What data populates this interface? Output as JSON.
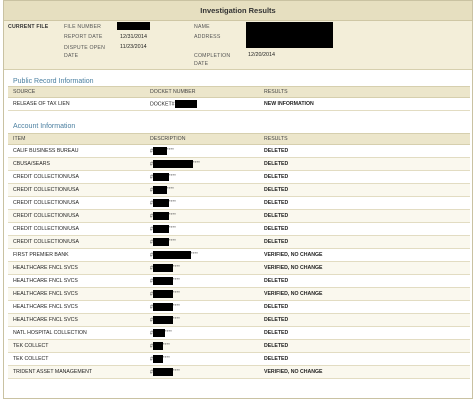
{
  "page_title": "Investigation Results",
  "summary": {
    "current_file_label": "CURRENT FILE",
    "file_number_label": "FILE NUMBER",
    "report_date_label": "REPORT DATE",
    "report_date": "12/31/2014",
    "dispute_open_label": "DISPUTE OPEN DATE",
    "dispute_open_date": "11/23/2014",
    "name_label": "NAME",
    "address_label": "ADDRESS",
    "completion_label": "COMPLETION DATE",
    "completion_date": "12/20/2014"
  },
  "public_record": {
    "title": "Public Record Information",
    "headers": [
      "SOURCE",
      "DOCKET NUMBER",
      "RESULTS"
    ],
    "rows": [
      {
        "source": "RELEASE OF TAX LIEN",
        "docket": "DOCKET#",
        "result": "NEW INFORMATION"
      }
    ]
  },
  "accounts": {
    "title": "Account Information",
    "headers": [
      "ITEM",
      "DESCRIPTION",
      "RESULTS"
    ],
    "rows": [
      {
        "item": "CALIF BUSINESS BUREAU",
        "desc_prefix": "#",
        "desc_suffix": "****",
        "result": "DELETED"
      },
      {
        "item": "CBUSA/SEARS",
        "desc_prefix": "#",
        "desc_suffix": "****",
        "result": "DELETED"
      },
      {
        "item": "CREDIT COLLECTION/USA",
        "desc_prefix": "#",
        "desc_suffix": "****",
        "result": "DELETED"
      },
      {
        "item": "CREDIT COLLECTION/USA",
        "desc_prefix": "#",
        "desc_suffix": "****",
        "result": "DELETED"
      },
      {
        "item": "CREDIT COLLECTION/USA",
        "desc_prefix": "#",
        "desc_suffix": "****",
        "result": "DELETED"
      },
      {
        "item": "CREDIT COLLECTION/USA",
        "desc_prefix": "#",
        "desc_suffix": "****",
        "result": "DELETED"
      },
      {
        "item": "CREDIT COLLECTION/USA",
        "desc_prefix": "#",
        "desc_suffix": "****",
        "result": "DELETED"
      },
      {
        "item": "CREDIT COLLECTION/USA",
        "desc_prefix": "#",
        "desc_suffix": "****",
        "result": "DELETED"
      },
      {
        "item": "FIRST PREMIER BANK",
        "desc_prefix": "#",
        "desc_suffix": "****",
        "result": "VERIFIED, NO CHANGE"
      },
      {
        "item": "HEALTHCARE FNCL SVCS",
        "desc_prefix": "#",
        "desc_suffix": "****",
        "result": "VERIFIED, NO CHANGE"
      },
      {
        "item": "HEALTHCARE FNCL SVCS",
        "desc_prefix": "#",
        "desc_suffix": "****",
        "result": "DELETED"
      },
      {
        "item": "HEALTHCARE FNCL SVCS",
        "desc_prefix": "#",
        "desc_suffix": "****",
        "result": "VERIFIED, NO CHANGE"
      },
      {
        "item": "HEALTHCARE FNCL SVCS",
        "desc_prefix": "#",
        "desc_suffix": "****",
        "result": "DELETED"
      },
      {
        "item": "HEALTHCARE FNCL SVCS",
        "desc_prefix": "#",
        "desc_suffix": "****",
        "result": "DELETED"
      },
      {
        "item": "NATL HOSPITAL COLLECTION",
        "desc_prefix": "#",
        "desc_suffix": "****",
        "result": "DELETED"
      },
      {
        "item": "TEK COLLECT",
        "desc_prefix": "#",
        "desc_suffix": "****",
        "result": "DELETED"
      },
      {
        "item": "TEK COLLECT",
        "desc_prefix": "#",
        "desc_suffix": "****",
        "result": "DELETED"
      },
      {
        "item": "TRIDENT ASSET MANAGEMENT",
        "desc_prefix": "#",
        "desc_suffix": "****",
        "result": "VERIFIED, NO CHANGE"
      }
    ]
  }
}
